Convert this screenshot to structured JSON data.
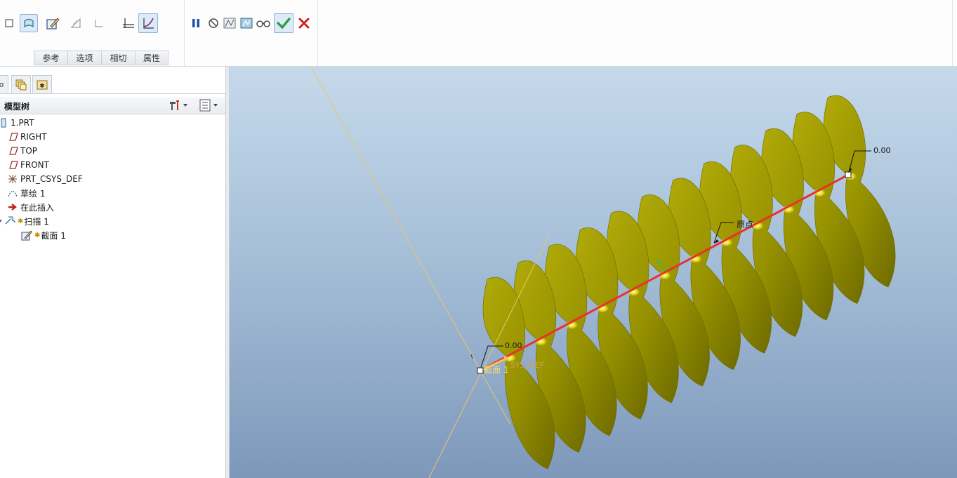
{
  "ribbon": {
    "tabs": [
      "参考",
      "选项",
      "相切",
      "属性"
    ]
  },
  "icons": {
    "solid": "solid-icon",
    "surface": "surface-icon",
    "sketch": "sketch-icon",
    "remove_material": "remove-material-icon",
    "thicken": "thicken-icon",
    "constant": "constant-section-icon",
    "variable": "variable-section-icon",
    "pause": "pause-icon",
    "no_preview": "no-preview-icon",
    "preview": "preview-icon",
    "verify": "verify-icon",
    "glasses": "glasses-icon",
    "ok": "checkmark-icon",
    "cancel": "cancel-x-icon"
  },
  "colors": {
    "accent_ok": "#2e9e3f",
    "cancel": "#d32020",
    "trajectory": "#e8322a",
    "surface": "#9a9500"
  },
  "panel": {
    "title": "模型树"
  },
  "tree": [
    {
      "label": "1.PRT"
    },
    {
      "label": "RIGHT"
    },
    {
      "label": "TOP"
    },
    {
      "label": "FRONT"
    },
    {
      "label": "PRT_CSYS_DEF"
    },
    {
      "label": "草绘 1"
    },
    {
      "label": "在此插入"
    },
    {
      "label": "扫描 1"
    },
    {
      "label": "截面 1"
    }
  ],
  "viewport": {
    "dim_end": "0.00",
    "dim_start": "0.00",
    "origin_label": "原点",
    "section_label": "截面 1",
    "csys_label": "SYS_DEF"
  }
}
